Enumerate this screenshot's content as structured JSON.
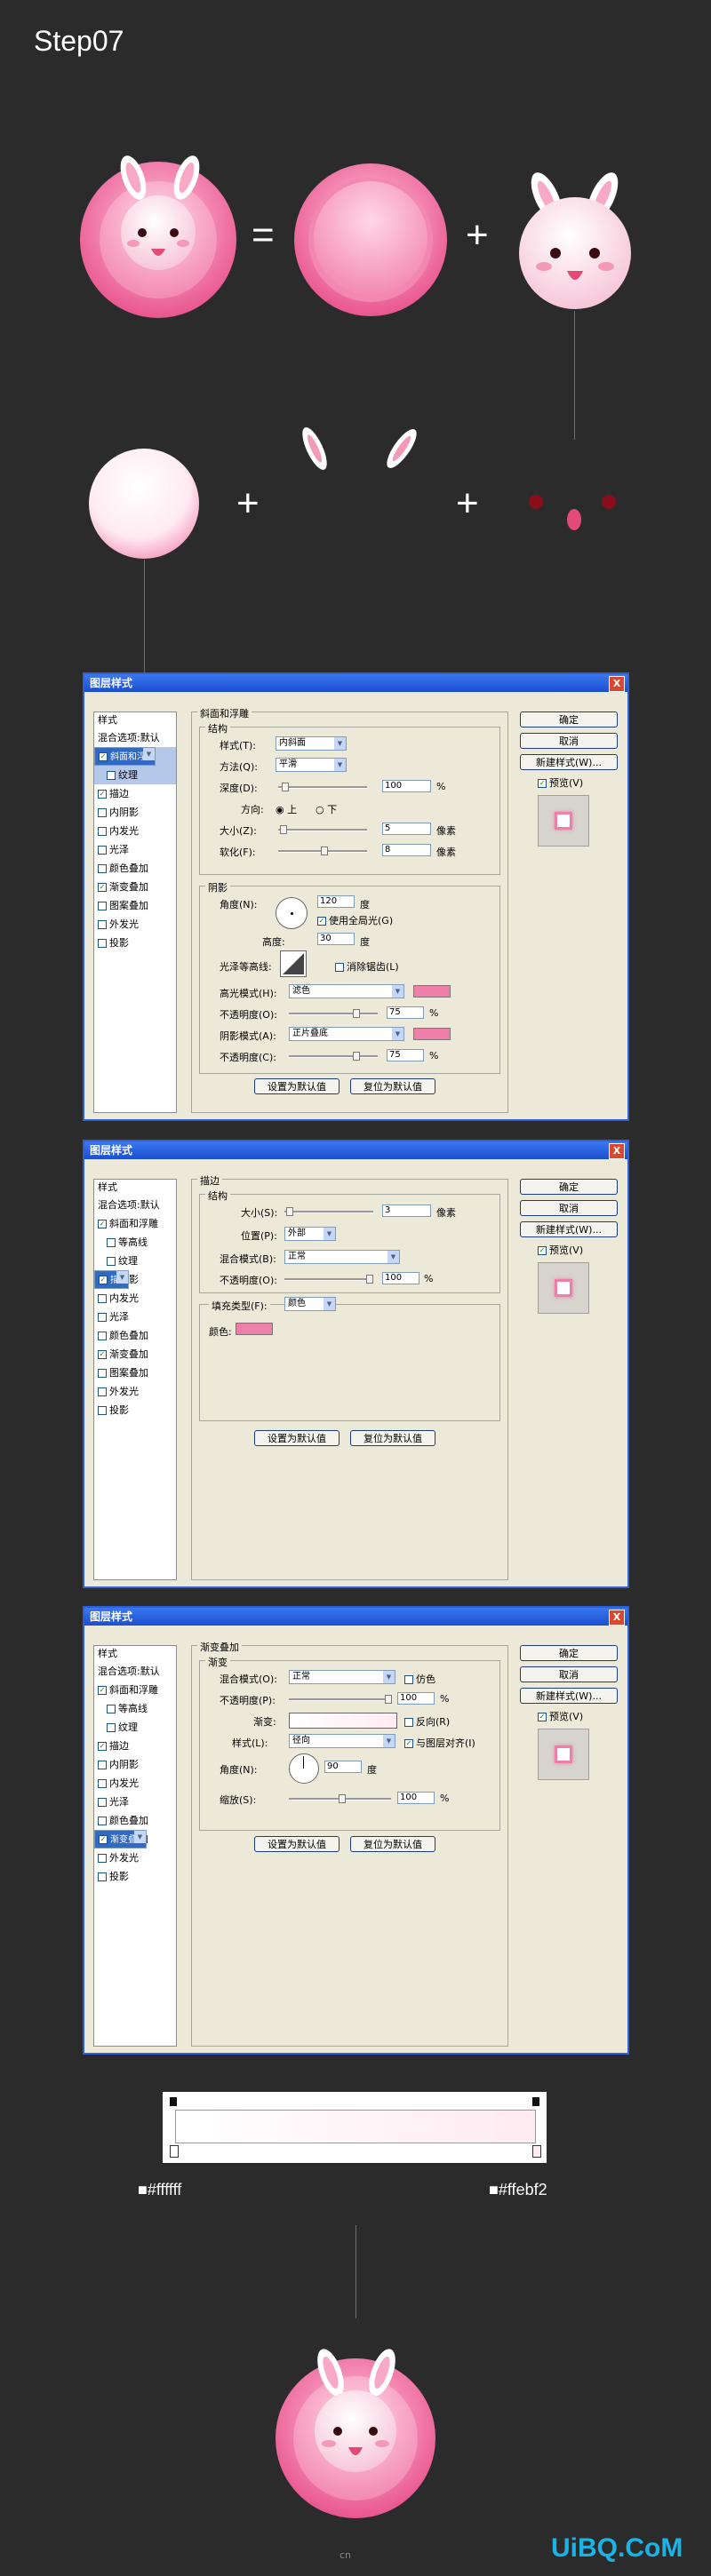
{
  "step_title": "Step07",
  "ops": {
    "equals": "=",
    "plus": "+"
  },
  "dialog_title": "图层样式",
  "close_label": "X",
  "style_list": {
    "header": "样式",
    "items": [
      "混合选项:默认",
      "斜面和浮雕",
      "等高线",
      "纹理",
      "描边",
      "内阴影",
      "内发光",
      "光泽",
      "颜色叠加",
      "渐变叠加",
      "图案叠加",
      "外发光",
      "投影"
    ]
  },
  "right_buttons": {
    "ok": "确定",
    "cancel": "取消",
    "new_style": "新建样式(W)...",
    "preview": "预览(V)"
  },
  "common": {
    "set_default": "设置为默认值",
    "reset_default": "复位为默认值"
  },
  "bevel": {
    "section": "斜面和浮雕",
    "structure": "结构",
    "style_label": "样式(T):",
    "style_value": "内斜面",
    "technique_label": "方法(Q):",
    "technique_value": "平滑",
    "depth_label": "深度(D):",
    "depth_value": "100",
    "percent": "%",
    "direction_label": "方向:",
    "dir_up": "上",
    "dir_down": "下",
    "size_label": "大小(Z):",
    "size_value": "5",
    "px": "像素",
    "soften_label": "软化(F):",
    "soften_value": "8",
    "shading": "阴影",
    "angle_label": "角度(N):",
    "angle_value": "120",
    "deg": "度",
    "global_light": "使用全局光(G)",
    "altitude_label": "高度:",
    "altitude_value": "30",
    "gloss_label": "光泽等高线:",
    "antialias": "消除锯齿(L)",
    "highlight_label": "高光模式(H):",
    "highlight_value": "滤色",
    "opacity1_label": "不透明度(O):",
    "opacity1_value": "75",
    "shadow_label": "阴影模式(A):",
    "shadow_value": "正片叠底",
    "opacity2_label": "不透明度(C):",
    "opacity2_value": "75"
  },
  "stroke": {
    "section": "描边",
    "structure": "结构",
    "size_label": "大小(S):",
    "size_value": "3",
    "px": "像素",
    "position_label": "位置(P):",
    "position_value": "外部",
    "blend_label": "混合模式(B):",
    "blend_value": "正常",
    "opacity_label": "不透明度(O):",
    "opacity_value": "100",
    "percent": "%",
    "fill_type_label": "填充类型(F):",
    "fill_type_value": "颜色",
    "color_label": "颜色:"
  },
  "gradient": {
    "section": "渐变叠加",
    "sub": "渐变",
    "blend_label": "混合模式(O):",
    "blend_value": "正常",
    "dither": "仿色",
    "opacity_label": "不透明度(P):",
    "opacity_value": "100",
    "percent": "%",
    "gradient_label": "渐变:",
    "reverse": "反向(R)",
    "style_label": "样式(L):",
    "style_value": "径向",
    "align": "与图层对齐(I)",
    "angle_label": "角度(N):",
    "angle_value": "90",
    "deg": "度",
    "scale_label": "缩放(S):",
    "scale_value": "100"
  },
  "gradient_stops": {
    "left": "#ffffff",
    "right": "#ffebf2"
  },
  "watermark": "UiBQ.CoM",
  "footer_small": "cn",
  "colors": {
    "pink": "#ee7fa8",
    "pink_light": "#ffebf2",
    "bg": "#2b2b2b",
    "dialog": "#ece9d8"
  }
}
